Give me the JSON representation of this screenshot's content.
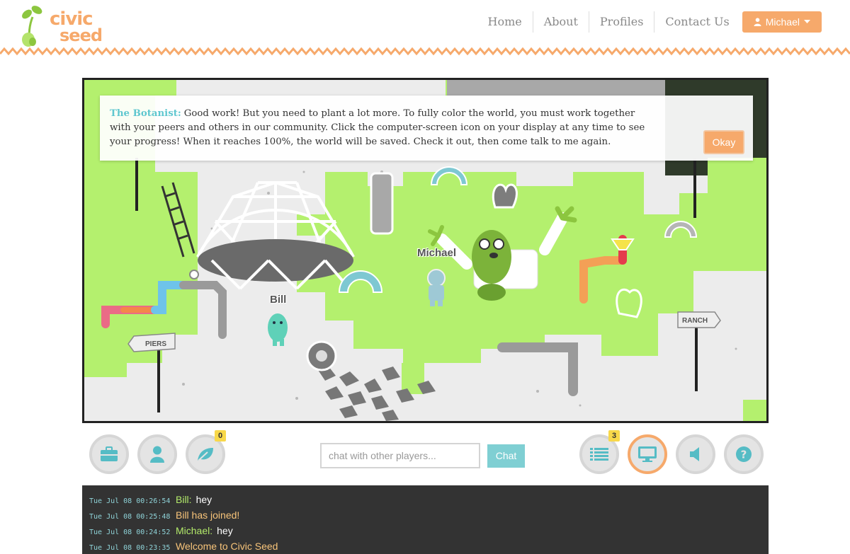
{
  "app": {
    "logo_top": "civic",
    "logo_bottom": "seed"
  },
  "nav": {
    "items": [
      "Home",
      "About",
      "Profiles",
      "Contact Us"
    ],
    "user_label": "Michael",
    "user_icon": "user-icon",
    "caret_icon": "caret-down-icon"
  },
  "colors": {
    "accent_orange": "#f6a96b",
    "teal": "#5fc7cf",
    "grass": "#b4f06e",
    "chat_bg": "#333333"
  },
  "game": {
    "dialog": {
      "speaker": "The Botanist:",
      "text": "Good work! But you need to plant a lot more. To fully color the world, you must work together with your peers and others in our community. Click the computer-screen icon on your display at any time to see your progress! When it reaches 100%, the world will be saved. Check it out, then come talk to me again.",
      "okay_label": "Okay"
    },
    "players": [
      "Michael",
      "Bill"
    ],
    "signs": [
      "PIERS",
      "RANCH"
    ]
  },
  "toolbar": {
    "left_buttons": [
      {
        "name": "inventory",
        "icon": "briefcase-icon"
      },
      {
        "name": "profile",
        "icon": "user-icon"
      },
      {
        "name": "seeds",
        "icon": "leaf-icon",
        "badge": "0"
      }
    ],
    "chat_placeholder": "chat with other players...",
    "chat_button": "Chat",
    "right_buttons": [
      {
        "name": "resume",
        "icon": "list-icon",
        "badge": "3"
      },
      {
        "name": "progress",
        "icon": "monitor-icon",
        "active": true
      },
      {
        "name": "sound",
        "icon": "speaker-icon"
      },
      {
        "name": "help",
        "icon": "question-circle-icon"
      }
    ]
  },
  "chat_log": [
    {
      "time": "Tue Jul 08 00:26:54",
      "name": "Bill:",
      "message": "hey"
    },
    {
      "time": "Tue Jul 08 00:25:48",
      "system": "Bill has joined!"
    },
    {
      "time": "Tue Jul 08 00:24:52",
      "name": "Michael:",
      "message": "hey"
    },
    {
      "time": "Tue Jul 08 00:23:35",
      "system": "Welcome to Civic Seed"
    }
  ]
}
